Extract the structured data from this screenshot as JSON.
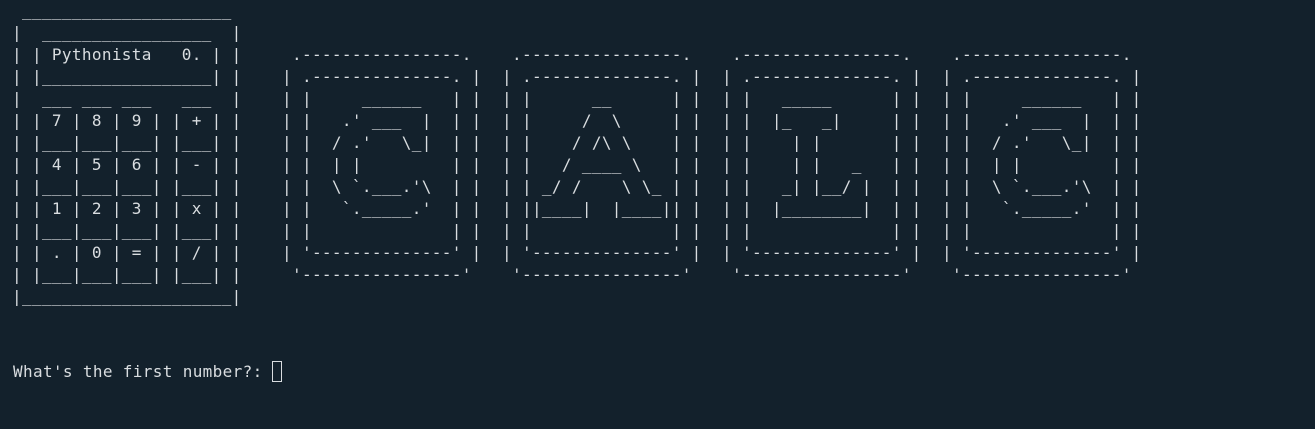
{
  "terminal": {
    "calculator_art": " _____________________\n|  _________________  |\n| | Pythonista   0. | |\n| |_________________| |\n|  ___ ___ ___   ___  |\n| | 7 | 8 | 9 | | + | |\n| |___|___|___| |___| |\n| | 4 | 5 | 6 | | - | |\n| |___|___|___| |___| |\n| | 1 | 2 | 3 | | x | |\n| |___|___|___| |___| |\n| | . | 0 | = | | / | |\n| |___|___|___| |___| |\n|_____________________|",
    "letters": [
      " .----------------.\n| .--------------. |\n| |     ______   | |\n| |   .' ___  |  | |\n| |  / .'   \\_|  | |\n| |  | |         | |\n| |  \\ `.___.'\\  | |\n| |   `._____.'  | |\n| |              | |\n| '--------------' |\n '----------------'",
      " .----------------.\n| .--------------. |\n| |      __      | |\n| |     /  \\     | |\n| |    / /\\ \\    | |\n| |   / ____ \\   | |\n| | _/ /    \\ \\_ | |\n| ||____|  |____|| |\n| |              | |\n| '--------------' |\n '----------------'",
      " .----------------.\n| .--------------. |\n| |   _____      | |\n| |  |_   _|     | |\n| |    | |       | |\n| |    | |   _   | |\n| |   _| |__/ |  | |\n| |  |________|  | |\n| |              | |\n| '--------------' |\n '----------------'",
      " .----------------.\n| .--------------. |\n| |     ______   | |\n| |   .' ___  |  | |\n| |  / .'   \\_|  | |\n| |  | |         | |\n| |  \\ `.___.'\\  | |\n| |   `._____.'  | |\n| |              | |\n| '--------------' |\n '----------------'"
    ],
    "prompt": "What's the first number?:"
  },
  "colors": {
    "background": "#13212c",
    "foreground": "#d9dde0"
  }
}
